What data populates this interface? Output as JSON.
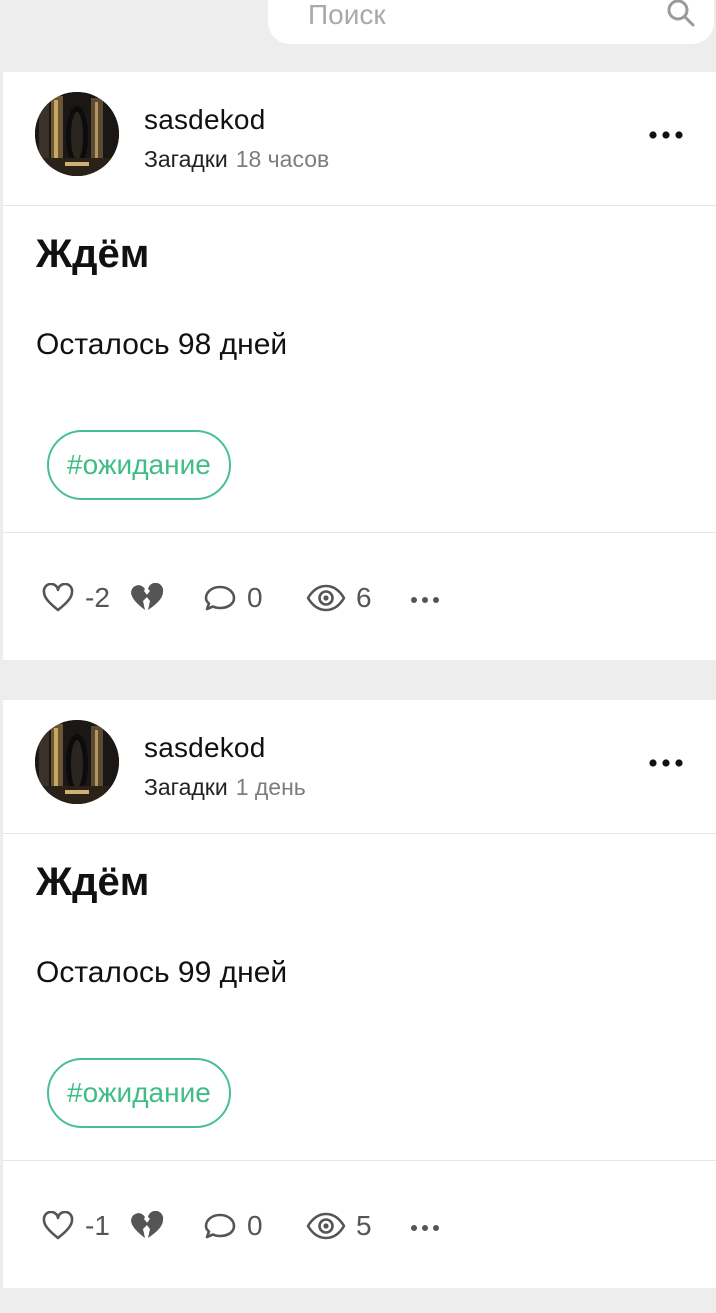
{
  "search": {
    "placeholder": "Поиск",
    "icon": "search-icon"
  },
  "posts": [
    {
      "author": "sasdekod",
      "category": "Загадки",
      "time": "18 часов",
      "title": "Ждём",
      "text": "Осталось 98 дней",
      "tag": "#ожидание",
      "rating": "-2",
      "comments": "0",
      "views": "6"
    },
    {
      "author": "sasdekod",
      "category": "Загадки",
      "time": "1 день",
      "title": "Ждём",
      "text": "Осталось 99 дней",
      "tag": "#ожидание",
      "rating": "-1",
      "comments": "0",
      "views": "5"
    }
  ],
  "colors": {
    "accent": "#47c08e",
    "background": "#ededed",
    "card": "#ffffff",
    "muted_text": "#7d7d7d",
    "icon": "#555555"
  }
}
